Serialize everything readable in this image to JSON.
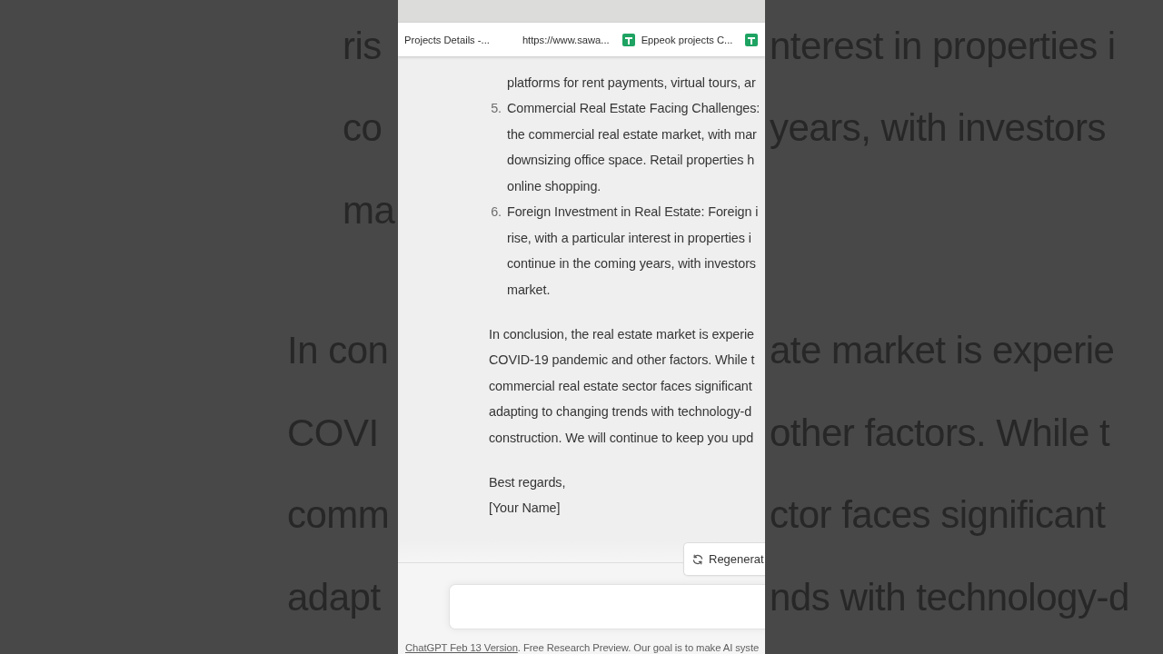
{
  "backdrop": {
    "blocks": [
      {
        "kind": "list",
        "lines": [
          {
            "left": "ris",
            "right": "nterest in properties i"
          },
          {
            "left": "co",
            "right": "years, with investors"
          },
          {
            "left": "ma"
          }
        ]
      },
      {
        "kind": "paragraph",
        "lines": [
          {
            "left": "In con",
            "right": "ate market is experie"
          },
          {
            "left": "COVI",
            "right": "other factors. While t"
          },
          {
            "left": "comm",
            "right": "ctor faces significant"
          },
          {
            "left": "adapt",
            "right": "nds with technology-d"
          }
        ]
      }
    ]
  },
  "browser": {
    "bookmarks": [
      {
        "kind": "page",
        "label": "Projects Details -..."
      },
      {
        "kind": "page",
        "label": "https://www.sawa..."
      },
      {
        "kind": "sheet",
        "label": "Eppeok projects C..."
      },
      {
        "kind": "sheet"
      }
    ]
  },
  "chat": {
    "blocks": [
      {
        "kind": "list",
        "items": [
          {
            "lines": [
              "platforms for rent payments, virtual tours, ar"
            ]
          },
          {
            "number": "5.",
            "lines": [
              "Commercial Real Estate Facing Challenges:",
              "the commercial real estate market, with mar",
              "downsizing office space. Retail properties h",
              "online shopping."
            ]
          },
          {
            "number": "6.",
            "lines": [
              "Foreign Investment in Real Estate: Foreign i",
              "rise, with a particular interest in properties i",
              "continue in the coming years, with investors",
              "market."
            ]
          }
        ]
      },
      {
        "kind": "paragraph",
        "lines": [
          "In conclusion, the real estate market is experie",
          "COVID-19 pandemic and other factors. While t",
          "commercial real estate sector faces significant",
          "adapting to changing trends with technology-d",
          "construction. We will continue to keep you upd"
        ]
      },
      {
        "kind": "paragraph",
        "lines": [
          "Best regards,",
          "[Your Name]"
        ]
      }
    ]
  },
  "regenerate_button": {
    "label": "Regenerat"
  },
  "footer": {
    "link": "ChatGPT Feb 13 Version",
    "text": ". Free Research Preview. Our goal is to make AI syste"
  }
}
